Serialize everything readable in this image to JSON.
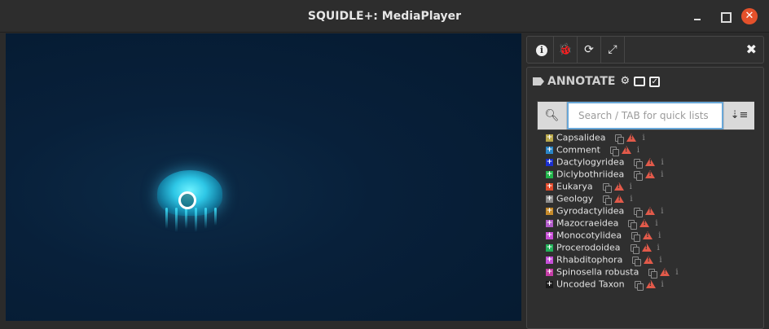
{
  "window": {
    "title": "SQUIDLE+: MediaPlayer",
    "close_symbol": "✕"
  },
  "toolbar": {
    "tools": [
      {
        "icon": "info-circle-icon"
      },
      {
        "icon": "bug-icon"
      },
      {
        "icon": "refresh-icon"
      },
      {
        "icon": "expand-icon"
      }
    ],
    "close_symbol": "✖"
  },
  "annotate": {
    "title": "ANNOTATE",
    "search": {
      "placeholder": "Search / TAB for quick lists",
      "value": ""
    },
    "labels": [
      {
        "name": "Capsalidea",
        "color": "#b9a84a"
      },
      {
        "name": "Comment",
        "color": "#2a86c7"
      },
      {
        "name": "Dactylogyridea",
        "color": "#1a2fd0"
      },
      {
        "name": "Diclybothriidea",
        "color": "#21b44a"
      },
      {
        "name": "Eukarya",
        "color": "#e14b2c"
      },
      {
        "name": "Geology",
        "color": "#8d8d8d"
      },
      {
        "name": "Gyrodactylidea",
        "color": "#c58a2a"
      },
      {
        "name": "Mazocraeidea",
        "color": "#b25bc9"
      },
      {
        "name": "Monocotylidea",
        "color": "#c94fd8"
      },
      {
        "name": "Procerodoidea",
        "color": "#22b25a"
      },
      {
        "name": "Rhabditophora",
        "color": "#c64fd9"
      },
      {
        "name": "Spinosella robusta",
        "color": "#c53da6"
      },
      {
        "name": "Uncoded Taxon",
        "color": "#1a1a1a"
      }
    ]
  }
}
